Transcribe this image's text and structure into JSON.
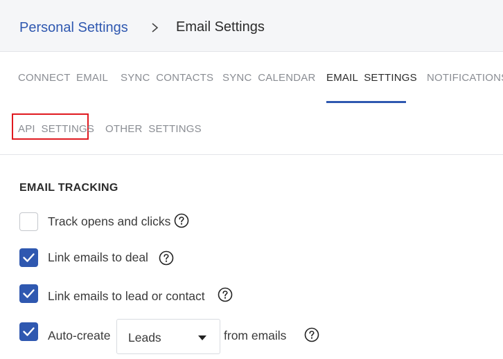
{
  "breadcrumb": {
    "parent": "Personal Settings",
    "current": "Email Settings"
  },
  "tabs": [
    {
      "label": "CONNECT  EMAIL",
      "active": false
    },
    {
      "label": "SYNC  CONTACTS",
      "active": false
    },
    {
      "label": "SYNC  CALENDAR",
      "active": false
    },
    {
      "label": "EMAIL  SETTINGS",
      "active": true
    },
    {
      "label": "NOTIFICATIONS",
      "active": false
    },
    {
      "label": "API  SETTINGS",
      "active": false,
      "highlighted": true
    },
    {
      "label": "OTHER  SETTINGS",
      "active": false
    }
  ],
  "email_tracking": {
    "title": "EMAIL TRACKING",
    "options": [
      {
        "label": "Track opens and clicks",
        "checked": false,
        "help_icon": "question-circle-icon"
      },
      {
        "label": "Link emails to deal",
        "checked": true,
        "help_icon": "question-circle-icon"
      },
      {
        "label": "Link emails to lead or contact",
        "checked": true,
        "help_icon": "question-circle-icon"
      },
      {
        "label_before": "Auto-create",
        "select_value": "Leads",
        "label_after": "from emails",
        "checked": true,
        "help_icon": "question-circle-icon"
      }
    ]
  },
  "colors": {
    "accent": "#2f58b0",
    "highlight_box": "#e0191f"
  }
}
